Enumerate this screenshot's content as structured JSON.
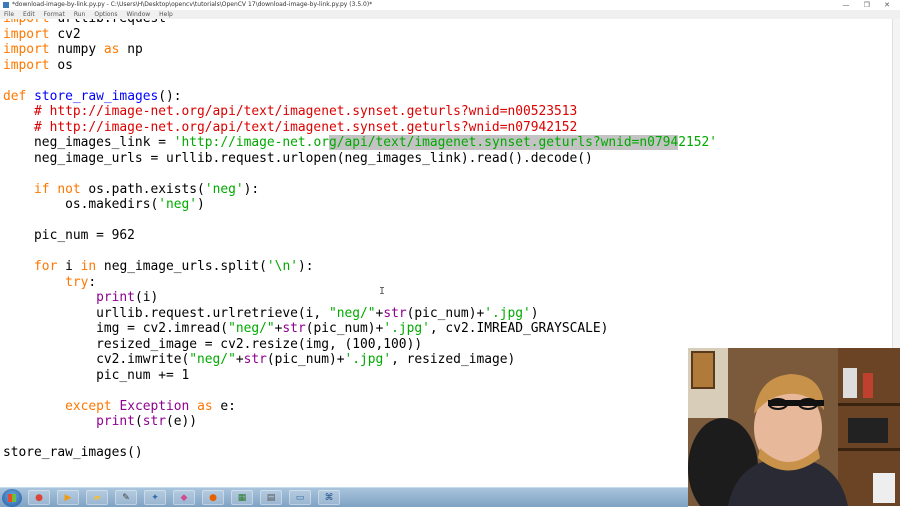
{
  "window": {
    "title": "*download-image-by-link.py.py - C:\\Users\\H\\Desktop\\opencv\\tutorials\\OpenCV 17\\download-image-by-link.py.py (3.5.0)*",
    "controls": "— ❐ ✕"
  },
  "menu": {
    "items": [
      "File",
      "Edit",
      "Format",
      "Run",
      "Options",
      "Window",
      "Help"
    ]
  },
  "code": {
    "lines": [
      [
        {
          "t": "import",
          "c": "kw"
        },
        {
          "t": " urllib.request"
        }
      ],
      [
        {
          "t": "import",
          "c": "kw"
        },
        {
          "t": " cv2"
        }
      ],
      [
        {
          "t": "import",
          "c": "kw"
        },
        {
          "t": " numpy "
        },
        {
          "t": "as",
          "c": "kw"
        },
        {
          "t": " np"
        }
      ],
      [
        {
          "t": "import",
          "c": "kw"
        },
        {
          "t": " os"
        }
      ],
      [],
      [
        {
          "t": "def",
          "c": "kw"
        },
        {
          "t": " "
        },
        {
          "t": "store_raw_images",
          "c": "def"
        },
        {
          "t": "():"
        }
      ],
      [
        {
          "t": "    "
        },
        {
          "t": "# http://image-net.org/api/text/imagenet.synset.geturls?wnid=n00523513",
          "c": "cmt"
        }
      ],
      [
        {
          "t": "    "
        },
        {
          "t": "# http://image-net.org/api/text/imagenet.synset.geturls?wnid=n07942152",
          "c": "cmt"
        }
      ],
      [
        {
          "t": "    neg_images_link = "
        },
        {
          "t": "'http://image-net.or",
          "c": "str"
        },
        {
          "t": "g/api/text/imagenet.synset.geturls?wnid=n0794",
          "c": "str sel"
        },
        {
          "t": "2152'",
          "c": "str"
        }
      ],
      [
        {
          "t": "    neg_image_urls = urllib.request.urlopen(neg_images_link).read().decode()"
        }
      ],
      [],
      [
        {
          "t": "    "
        },
        {
          "t": "if",
          "c": "kw"
        },
        {
          "t": " "
        },
        {
          "t": "not",
          "c": "kw"
        },
        {
          "t": " os.path.exists("
        },
        {
          "t": "'neg'",
          "c": "str"
        },
        {
          "t": "):"
        }
      ],
      [
        {
          "t": "        os.makedirs("
        },
        {
          "t": "'neg'",
          "c": "str"
        },
        {
          "t": ")"
        }
      ],
      [],
      [
        {
          "t": "    pic_num = 962"
        }
      ],
      [],
      [
        {
          "t": "    "
        },
        {
          "t": "for",
          "c": "kw"
        },
        {
          "t": " i "
        },
        {
          "t": "in",
          "c": "kw"
        },
        {
          "t": " neg_image_urls.split("
        },
        {
          "t": "'\\n'",
          "c": "str"
        },
        {
          "t": "):"
        }
      ],
      [
        {
          "t": "        "
        },
        {
          "t": "try",
          "c": "kw"
        },
        {
          "t": ":"
        }
      ],
      [
        {
          "t": "            "
        },
        {
          "t": "print",
          "c": "bi"
        },
        {
          "t": "(i)"
        }
      ],
      [
        {
          "t": "            urllib.request.urlretrieve(i, "
        },
        {
          "t": "\"neg/\"",
          "c": "str"
        },
        {
          "t": "+"
        },
        {
          "t": "str",
          "c": "bi"
        },
        {
          "t": "(pic_num)+"
        },
        {
          "t": "'.jpg'",
          "c": "str"
        },
        {
          "t": ")"
        }
      ],
      [
        {
          "t": "            img = cv2.imread("
        },
        {
          "t": "\"neg/\"",
          "c": "str"
        },
        {
          "t": "+"
        },
        {
          "t": "str",
          "c": "bi"
        },
        {
          "t": "(pic_num)+"
        },
        {
          "t": "'.jpg'",
          "c": "str"
        },
        {
          "t": ", cv2.IMREAD_GRAYSCALE)"
        }
      ],
      [
        {
          "t": "            resized_image = cv2.resize(img, (100,100))"
        }
      ],
      [
        {
          "t": "            cv2.imwrite("
        },
        {
          "t": "\"neg/\"",
          "c": "str"
        },
        {
          "t": "+"
        },
        {
          "t": "str",
          "c": "bi"
        },
        {
          "t": "(pic_num)+"
        },
        {
          "t": "'.jpg'",
          "c": "str"
        },
        {
          "t": ", resized_image)"
        }
      ],
      [
        {
          "t": "            pic_num += 1"
        }
      ],
      [],
      [
        {
          "t": "        "
        },
        {
          "t": "except",
          "c": "kw"
        },
        {
          "t": " "
        },
        {
          "t": "Exception",
          "c": "bi"
        },
        {
          "t": " "
        },
        {
          "t": "as",
          "c": "kw"
        },
        {
          "t": " e:"
        }
      ],
      [
        {
          "t": "            "
        },
        {
          "t": "print",
          "c": "bi"
        },
        {
          "t": "("
        },
        {
          "t": "str",
          "c": "bi"
        },
        {
          "t": "(e))"
        }
      ],
      [],
      [
        {
          "t": "store_raw_images()"
        }
      ]
    ]
  },
  "colors": {
    "keyword": "#ff7700",
    "definition": "#0000ff",
    "string": "#00aa00",
    "comment": "#dd0000",
    "builtin": "#900090",
    "selection": "#c3c3c3"
  },
  "taskbar": {
    "items": [
      {
        "icon": "chrome-icon"
      },
      {
        "icon": "media-player-icon"
      },
      {
        "icon": "folder-icon"
      },
      {
        "icon": "tool-icon"
      },
      {
        "icon": "python-icon"
      },
      {
        "icon": "paint-icon"
      },
      {
        "icon": "firefox-icon"
      },
      {
        "icon": "app-icon"
      },
      {
        "icon": "note-icon"
      },
      {
        "icon": "window-icon"
      },
      {
        "icon": "idle-icon"
      }
    ]
  }
}
